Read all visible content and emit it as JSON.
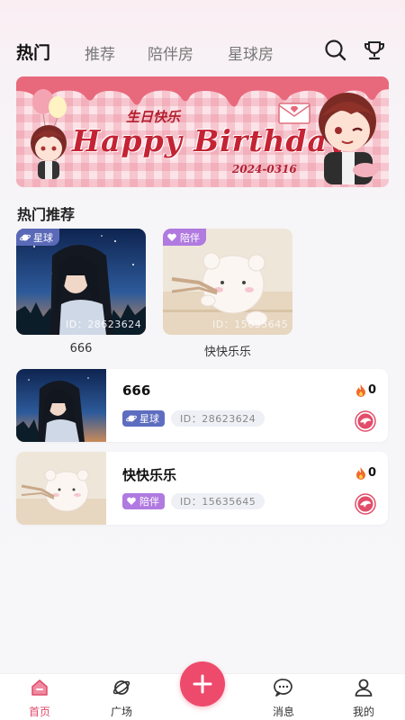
{
  "tabs": [
    {
      "label": "热门",
      "active": true
    },
    {
      "label": "推荐",
      "active": false
    },
    {
      "label": "陪伴房",
      "active": false
    },
    {
      "label": "星球房",
      "active": false
    }
  ],
  "header_icons": [
    "search-icon",
    "trophy-icon"
  ],
  "banner": {
    "small_text": "生日快乐",
    "title": "Happy Birthday",
    "date": "2024-0316"
  },
  "section": {
    "title": "热门推荐"
  },
  "cards": [
    {
      "badge": "星球",
      "id_text": "ID：28623624",
      "name": "666",
      "badge_color": "#5a6ab8"
    },
    {
      "badge": "陪伴",
      "id_text": "ID：15635645",
      "name": "快快乐乐",
      "badge_color": "#b07ae0"
    }
  ],
  "rooms": [
    {
      "name": "666",
      "tag": "星球",
      "tag_color": "#5d6dbf",
      "id_text": "ID：28623624",
      "heat": "0"
    },
    {
      "name": "快快乐乐",
      "tag": "陪伴",
      "tag_color": "#b07ae0",
      "id_text": "ID：15635645",
      "heat": "0"
    }
  ],
  "nav": [
    {
      "label": "首页",
      "active": true
    },
    {
      "label": "广场",
      "active": false
    },
    {
      "label": "消息",
      "active": false
    },
    {
      "label": "我的",
      "active": false
    }
  ],
  "colors": {
    "accent": "#ee4a6c",
    "active_nav": "#e04a6a"
  }
}
